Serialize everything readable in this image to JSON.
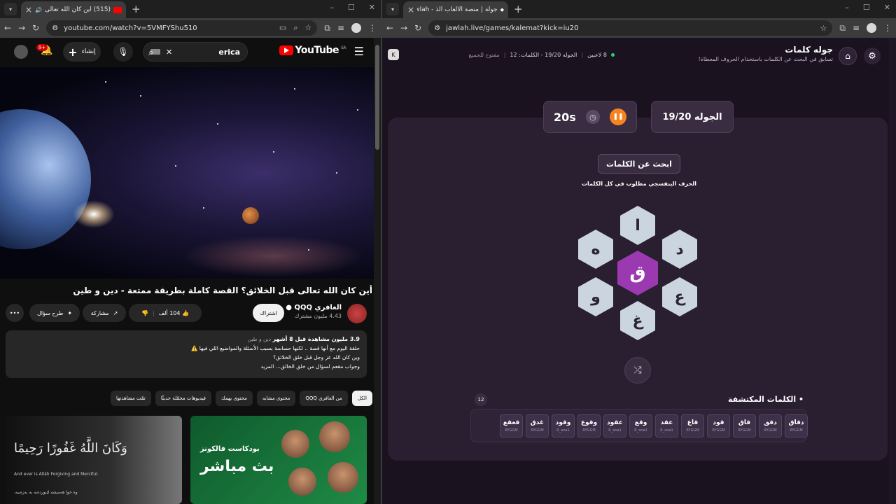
{
  "left_browser": {
    "tab_title": "(515) أين كان الله تعالى قبل ا...",
    "url": "youtube.com/watch?v=5VMFYShu510",
    "youtube": {
      "logo": "YouTube",
      "region": "SA",
      "search_value": "erica",
      "create_label": "إنشاء",
      "notif_count": "9+",
      "video": {
        "title": "أين كان الله تعالى قبل الخلائق؟ القصة كاملة بطريقة ممتعة - دين و طين",
        "channel": "الغافري QQQ",
        "subscribers": "4.43 مليون مشترك",
        "subscribe_label": "اشتراك",
        "likes": "104 ألف",
        "share_label": "مشاركة",
        "ask_label": "طرح سؤال"
      },
      "description": {
        "stats": "3.9 مليون مشاهدة  قبل 8 أشهر",
        "tag": "دين و طين",
        "line1": "حلقة اليوم مع أنها قصة .. لكنها حساسة بسبب الأسئلة والمواضيع اللي فيها ⚠️",
        "line2": "وين كان الله عز وجل قبل خلق الخلائق؟",
        "line3": "وجواب مقعم لسؤال من خلق الخالق...",
        "more": "المزيد"
      },
      "chips": [
        "الكل",
        "من الغافري QQQ",
        "محتوى مشابه",
        "محتوى يهمك",
        "فيديوهات محمّلة حديثًا",
        "تمّت مشاهدتها"
      ],
      "thumb1": {
        "quran": "وَكَانَ اللَّهُ غَفُورًا رَحِيمًا",
        "english": "And ever is Allāh Forgiving and Merciful.",
        "kurdish": "وە خوا هەمیشە لێبوردەیە بە بەزەییە."
      },
      "thumb2": {
        "title": "بودكاست فالكونز",
        "live": "بث مباشر"
      }
    }
  },
  "right_browser": {
    "tab_title": "جولة | منصة الألعاب الذ - Jawlah",
    "url": "jawlah.live/games/kalemat?kick=iu20",
    "header": {
      "title": "جوله كلمات",
      "subtitle": "تسابق في البحث عن الكلمات باستخدام الحروف المعطاة!",
      "players": "8 لاعبين",
      "round_info": "الجوله 19/20 - الكلمات: 12",
      "open": "مفتوح للجميع"
    },
    "round": "الجوله 19/20",
    "timer": "20s",
    "search_label": "ابحث عن الكلمات",
    "hint": "الحرف البنفسجي مطلوب في كل الكلمات",
    "letters": {
      "center": "ق",
      "top": "ا",
      "top_right": "د",
      "bottom_right": "ع",
      "bottom": "غ",
      "bottom_left": "و",
      "top_left": "ه"
    },
    "found_title": "الكلمات المكتشفة",
    "found_count": "12",
    "words": [
      {
        "w": "دقاق",
        "u": "RYGGM"
      },
      {
        "w": "دقق",
        "u": "RYGGM"
      },
      {
        "w": "قاق",
        "u": "RYGGM"
      },
      {
        "w": "قود",
        "u": "RYGGM"
      },
      {
        "w": "قاع",
        "u": "RYGGM"
      },
      {
        "w": "عقد",
        "u": "R_ana1"
      },
      {
        "w": "وقع",
        "u": "R_ana1"
      },
      {
        "w": "عقود",
        "u": "R_ana1"
      },
      {
        "w": "وقوع",
        "u": "RYGGM"
      },
      {
        "w": "وقود",
        "u": "R_ana1"
      },
      {
        "w": "غدق",
        "u": "RYGGM"
      },
      {
        "w": "قعقع",
        "u": "RYGGM"
      }
    ]
  },
  "colors": {
    "yt_red": "#ff0000",
    "jawlah_purple": "#9b39b0",
    "accent_orange": "#f5831f"
  }
}
